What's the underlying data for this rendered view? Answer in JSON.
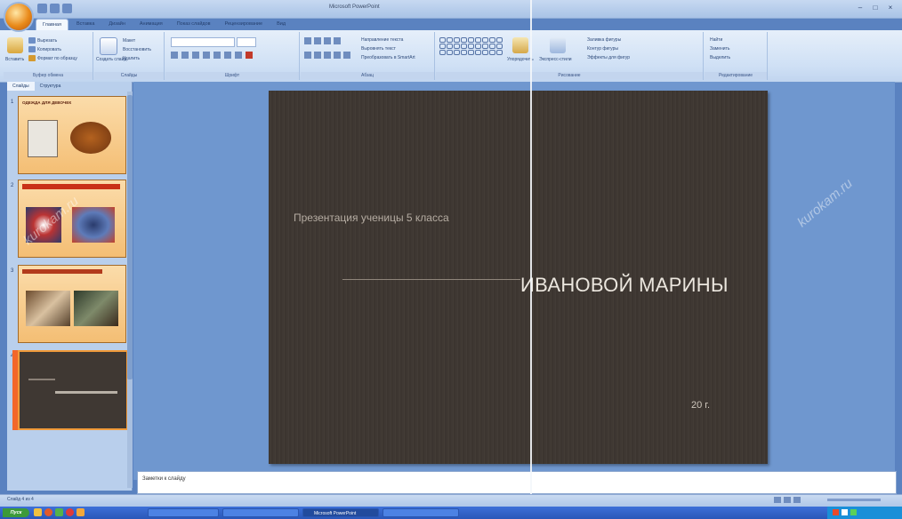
{
  "window": {
    "title": "Microsoft PowerPoint",
    "controls": [
      "–",
      "□",
      "×"
    ]
  },
  "ribbon": {
    "tabs": [
      "Главная",
      "Вставка",
      "Дизайн",
      "Анимация",
      "Показ слайдов",
      "Рецензирование",
      "Вид"
    ],
    "active_tab": 0,
    "groups": {
      "clipboard": {
        "label": "Буфер обмена",
        "paste": "Вставить",
        "cut": "Вырезать",
        "copy": "Копировать",
        "format": "Формат по образцу"
      },
      "slides": {
        "label": "Слайды",
        "new_slide": "Создать слайд",
        "layout": "Макет",
        "reset": "Восстановить",
        "delete": "Удалить"
      },
      "font": {
        "label": "Шрифт"
      },
      "paragraph": {
        "label": "Абзац",
        "direction": "Направление текста",
        "align": "Выровнять текст",
        "smartart": "Преобразовать в SmartArt"
      },
      "drawing": {
        "label": "Рисование",
        "arrange": "Упорядочить",
        "styles": "Экспресс-стили",
        "fill": "Заливка фигуры",
        "outline": "Контур фигуры",
        "effects": "Эффекты для фигур"
      },
      "editing": {
        "label": "Редактирование",
        "find": "Найти",
        "replace": "Заменить",
        "select": "Выделить"
      }
    }
  },
  "slide_pane": {
    "tabs": [
      "Слайды",
      "Структура"
    ],
    "thumbnails": [
      {
        "num": "1",
        "title": "ОДЕЖДА ДЛЯ ДЕВОЧЕК"
      },
      {
        "num": "2",
        "title": ""
      },
      {
        "num": "3",
        "title": ""
      },
      {
        "num": "4",
        "title": ""
      }
    ]
  },
  "slide": {
    "subtitle": "Презентация ученицы 5 класса",
    "title": "ИВАНОВОЙ МАРИНЫ",
    "year": "20  г."
  },
  "notes": {
    "placeholder": "Заметки к слайду"
  },
  "status_bar": {
    "slide_info": "Слайд 4 из 4"
  },
  "taskbar": {
    "start": "Пуск",
    "tasks": [
      "Microsoft PowerPoint"
    ]
  },
  "watermark": "kurokam.ru"
}
